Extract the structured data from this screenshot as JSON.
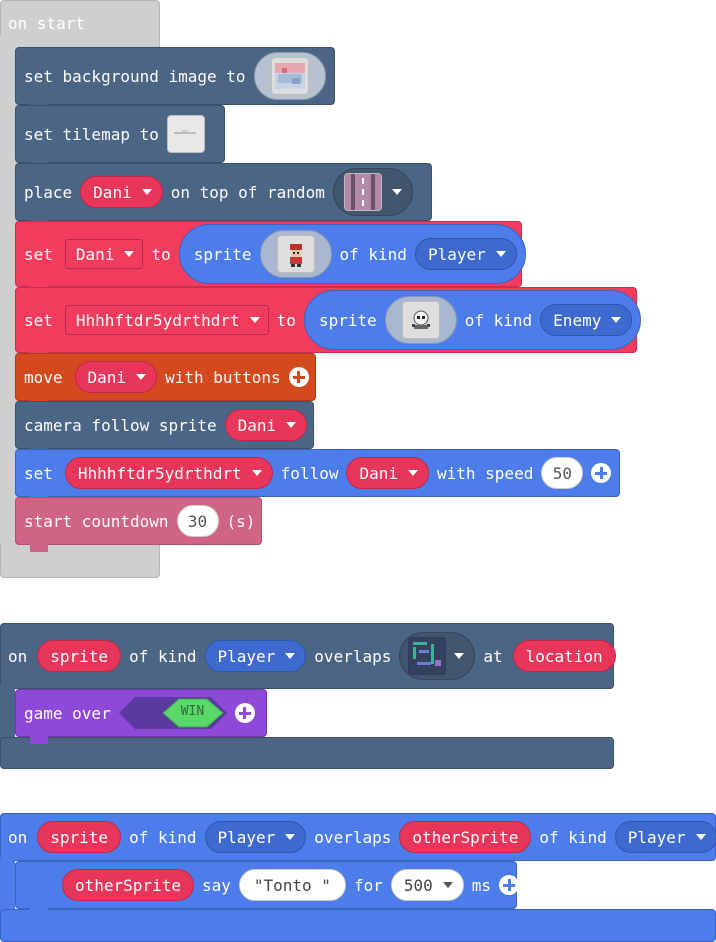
{
  "on_start": {
    "hat_label": "on start",
    "set_bg": {
      "label": "set background image to",
      "icon": "background-image-thumbnail"
    },
    "set_tilemap": {
      "label": "set tilemap to",
      "icon": "tilemap-thumbnail"
    },
    "place": {
      "label1": "place",
      "var": "Dani",
      "label2": "on top of random",
      "icon": "tile-thumbnail"
    },
    "set_dani": {
      "label1": "set",
      "var": "Dani",
      "label2": "to",
      "sprite_label": "sprite",
      "icon": "player-sprite-thumbnail",
      "kind_label": "of kind",
      "kind": "Player"
    },
    "set_enemy": {
      "label1": "set",
      "var": "Hhhhftdr5ydrthdrt",
      "label2": "to",
      "sprite_label": "sprite",
      "icon": "enemy-sprite-thumbnail",
      "kind_label": "of kind",
      "kind": "Enemy"
    },
    "move": {
      "label1": "move",
      "var": "Dani",
      "label2": "with buttons"
    },
    "camera": {
      "label1": "camera follow sprite",
      "var": "Dani"
    },
    "follow": {
      "label1": "set",
      "var1": "Hhhhftdr5ydrthdrt",
      "label2": "follow",
      "var2": "Dani",
      "label3": "with speed",
      "speed": "50"
    },
    "countdown": {
      "label1": "start countdown",
      "value": "30",
      "unit": "(s)"
    }
  },
  "overlap_tile": {
    "on": "on",
    "sprite": "sprite",
    "kind_label": "of kind",
    "kind": "Player",
    "overlaps": "overlaps",
    "icon": "tile-thumbnail",
    "at": "at",
    "location": "location",
    "game_over": {
      "label": "game over",
      "result": "WIN"
    }
  },
  "overlap_sprite": {
    "on": "on",
    "sprite": "sprite",
    "kind_label": "of kind",
    "kind": "Player",
    "overlaps": "overlaps",
    "other": "otherSprite",
    "kind_label2": "of kind",
    "kind2": "Player",
    "say": {
      "var": "otherSprite",
      "label": "say",
      "text": "\"Tonto \"",
      "for": "for",
      "ms_value": "500",
      "ms": "ms"
    }
  },
  "colors": {
    "scene": "#4b6584",
    "sprites": "#f23c5e",
    "blue": "#4c7dea",
    "controller": "#d5491f",
    "info": "#d06484",
    "game": "#8e49d9",
    "hat_gray": "#cfcfcf"
  }
}
